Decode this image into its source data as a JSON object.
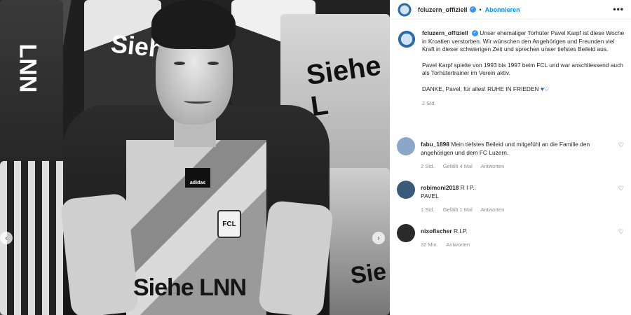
{
  "post": {
    "username": "fcluzern_offiziell",
    "follow_label": "Abonnieren",
    "more_label": "•••",
    "photo_text": {
      "sponsor": "Siehe LNN",
      "sponsor_short": "Siehe L",
      "sponsor_left": "LNN",
      "sponsor_right": "Sie",
      "logo": "adidas",
      "badge": "FCL"
    }
  },
  "caption": {
    "username": "fcluzern_offiziell",
    "paragraph1": "Unser ehemaliger Torhüter Pavel Karpf ist diese Woche in Kroatien verstorben. Wir wünschen den Angehörigen und Freunden viel Kraft in dieser schwierigen Zeit und sprechen unser tiefstes Beileid aus.",
    "paragraph2": "Pavel Karpf spielte von 1993 bis 1997 beim FCL und war anschliessend auch als Torhütertrainer im Verein aktiv.",
    "paragraph3": "DANKE, Pavel, für alles! RUHE IN FRIEDEN",
    "time": "2 Std."
  },
  "comments": [
    {
      "username": "fabu_1898",
      "text": "Mein tiefstes Beileid und mitgefühl an die Familie den angehörigen und dem FC Luzern.",
      "time": "2 Std.",
      "likes": "Gefällt 4 Mal",
      "reply": "Antworten",
      "avatar_color": "#8aa6c8"
    },
    {
      "username": "robimoni2018",
      "text": "R I P..\nPAVEL",
      "time": "1 Std.",
      "likes": "Gefällt 1 Mal",
      "reply": "Antworten",
      "avatar_color": "#3b5a7a"
    },
    {
      "username": "nixofischer",
      "text": "R.I.P.",
      "time": "32 Min.",
      "likes": "",
      "reply": "Antworten",
      "avatar_color": "#2a2a2a"
    }
  ],
  "colors": {
    "accent_blue": "#0095f6",
    "verified_blue": "#3897f0",
    "muted_text": "#8e8e8e"
  }
}
